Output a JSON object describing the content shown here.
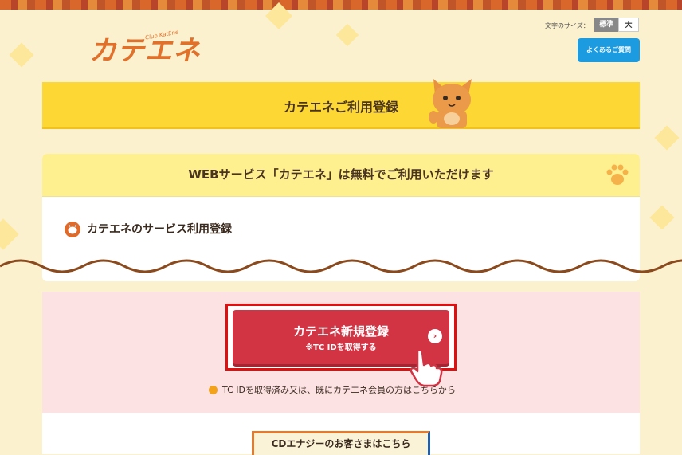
{
  "header": {
    "logo_text": "カテエネ",
    "logo_sub": "Club KatEne",
    "font_size_label": "文字のサイズ：",
    "font_size_standard": "標準",
    "font_size_large": "大",
    "faq_label": "よくあるご質問"
  },
  "page_title": "カテエネご利用登録",
  "card": {
    "heading": "WEBサービス「カテエネ」は無料でご利用いただけます",
    "service_label": "カテエネのサービス利用登録"
  },
  "register": {
    "main_label": "カテエネ新規登録",
    "sub_label": "※TC IDを取得する",
    "arrow": "›"
  },
  "login_link": "TC IDを取得済み又は、既にカテエネ会員の方はこちらから",
  "cd_button": "CDエナジーのお客さまはこちら",
  "colors": {
    "accent_yellow": "#fdd835",
    "register_red": "#d23444",
    "faq_blue": "#1c9be0"
  }
}
